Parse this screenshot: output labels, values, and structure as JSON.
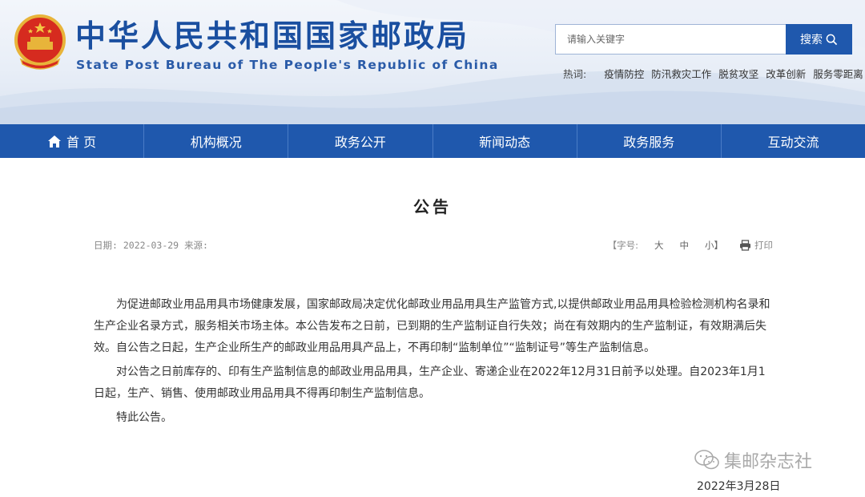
{
  "header": {
    "site_title": "中华人民共和国国家邮政局",
    "site_subtitle": "State Post Bureau of The People's Republic of China",
    "search_placeholder": "请输入关键字",
    "search_button": "搜索",
    "hot_label": "热词:",
    "hot_words": [
      "疫情防控",
      "防汛救灾工作",
      "脱贫攻坚",
      "改革创新",
      "服务零距离"
    ]
  },
  "nav": {
    "items": [
      "首 页",
      "机构概况",
      "政务公开",
      "新闻动态",
      "政务服务",
      "互动交流"
    ]
  },
  "article": {
    "title": "公告",
    "date_label": "日期:",
    "date": "2022-03-29",
    "source_label": "来源:",
    "font_size_label": "【字号:",
    "font_sizes": [
      "大",
      "中",
      "小】"
    ],
    "print_label": "打印",
    "paragraphs": [
      "为促进邮政业用品用具市场健康发展，国家邮政局决定优化邮政业用品用具生产监管方式,以提供邮政业用品用具检验检测机构名录和生产企业名录方式，服务相关市场主体。本公告发布之日前，已到期的生产监制证自行失效；尚在有效期内的生产监制证，有效期满后失效。自公告之日起，生产企业所生产的邮政业用品用具产品上，不再印制“监制单位”“监制证号”等生产监制信息。",
      "对公告之日前库存的、印有生产监制信息的邮政业用品用具，生产企业、寄递企业在2022年12月31日前予以处理。自2023年1月1日起，生产、销售、使用邮政业用品用具不得再印制生产监制信息。",
      "特此公告。"
    ],
    "watermark": "集邮杂志社",
    "sign_date": "2022年3月28日"
  },
  "colors": {
    "brand_blue": "#1f58ad",
    "title_blue": "#1a4fa0"
  }
}
